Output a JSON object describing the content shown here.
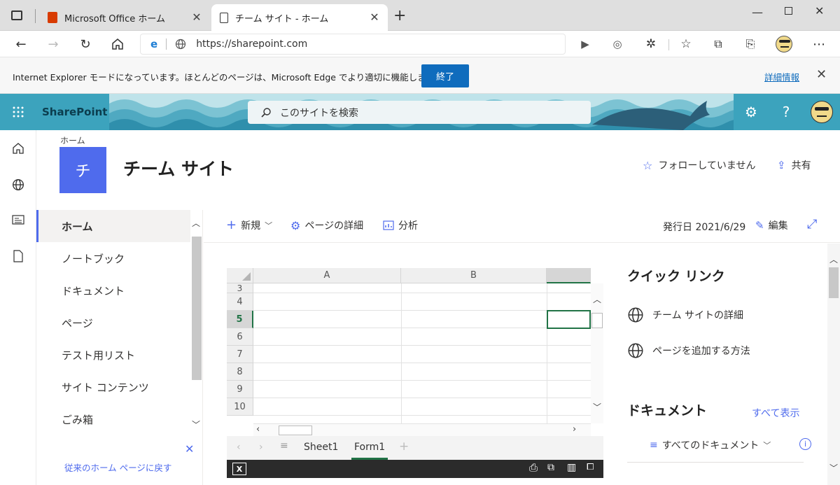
{
  "browser": {
    "tabs": [
      {
        "title": "Microsoft Office ホーム",
        "icon": "office-icon"
      },
      {
        "title": "チーム サイト - ホーム",
        "icon": "page-icon"
      }
    ],
    "url": "https://sharepoint.com",
    "ie_mode": {
      "message": "Internet Explorer モードになっています。ほとんどのページは、Microsoft Edge でより適切に機能します。",
      "end_button": "終了",
      "details_link": "詳細情報"
    }
  },
  "suitebar": {
    "app_name": "SharePoint",
    "search_placeholder": "このサイトを検索",
    "accent": "#3ca3bd"
  },
  "site": {
    "breadcrumb": "ホーム",
    "logo_letter": "チ",
    "logo_color": "#4f6bed",
    "title": "チーム サイト",
    "follow": "フォローしていません",
    "share": "共有"
  },
  "nav": {
    "items": [
      "ホーム",
      "ノートブック",
      "ドキュメント",
      "ページ",
      "テスト用リスト",
      "サイト コンテンツ",
      "ごみ箱"
    ],
    "return_link": "従来のホーム ページに戻す"
  },
  "commandbar": {
    "new": "新規",
    "page_details": "ページの詳細",
    "analytics": "分析",
    "published": "発行日 2021/6/29",
    "edit": "編集"
  },
  "excel": {
    "columns": [
      "A",
      "B"
    ],
    "rows": [
      "3",
      "4",
      "5",
      "6",
      "7",
      "8",
      "9",
      "10"
    ],
    "sheets": [
      "Sheet1",
      "Form1"
    ],
    "active_sheet": "Form1"
  },
  "quicklinks": {
    "title": "クイック リンク",
    "items": [
      "チーム サイトの詳細",
      "ページを追加する方法"
    ]
  },
  "documents": {
    "title": "ドキュメント",
    "see_all": "すべて表示",
    "view": "すべてのドキュメント"
  }
}
